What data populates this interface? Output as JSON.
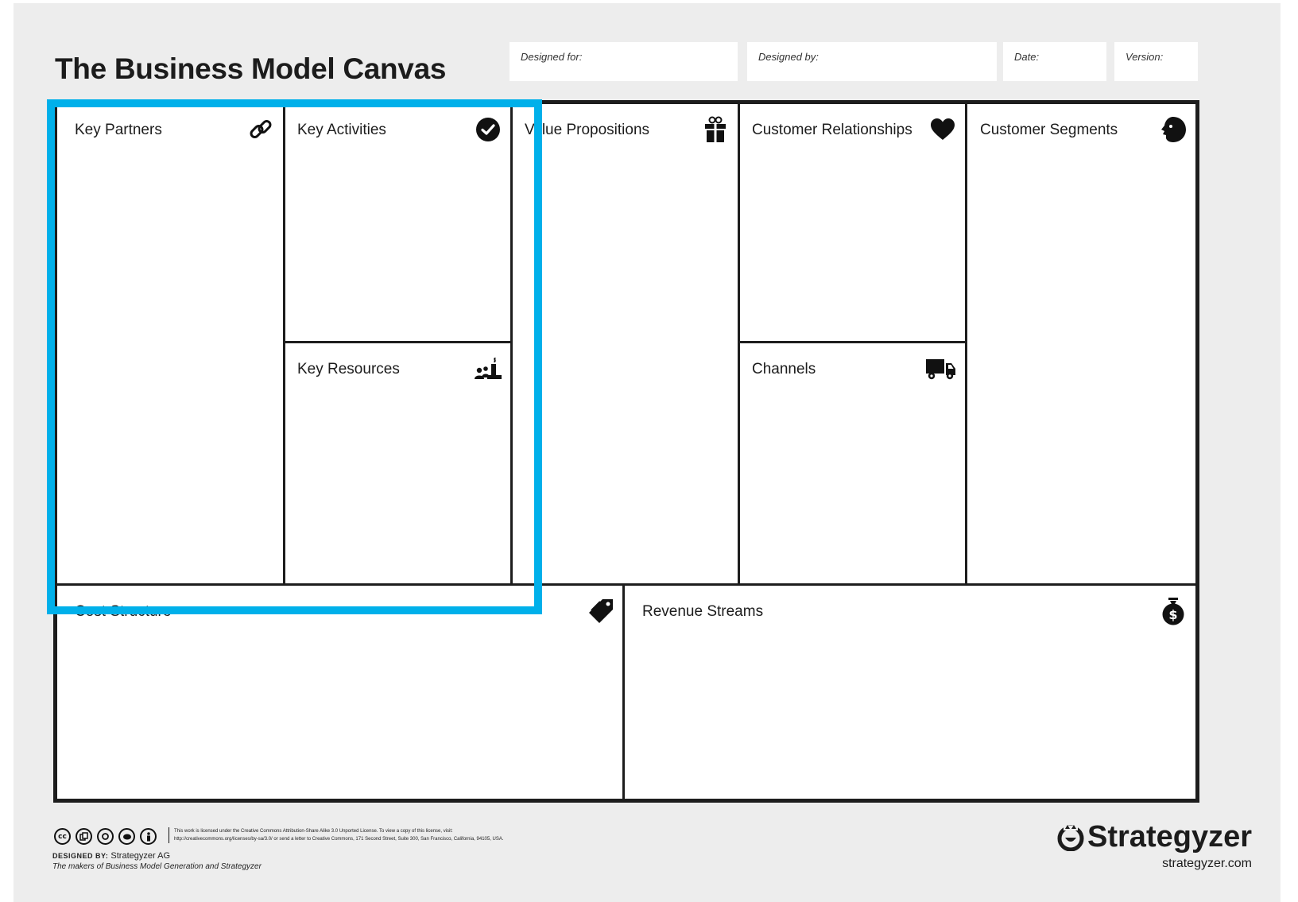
{
  "header": {
    "title": "The Business Model Canvas",
    "fields": [
      {
        "label": "Designed for:"
      },
      {
        "label": "Designed by:"
      },
      {
        "label": "Date:"
      },
      {
        "label": "Version:"
      }
    ]
  },
  "blocks": {
    "key_partners": {
      "label": "Key Partners",
      "icon": "link-icon"
    },
    "key_activities": {
      "label": "Key Activities",
      "icon": "check-circle-icon"
    },
    "key_resources": {
      "label": "Key Resources",
      "icon": "factory-people-icon"
    },
    "value_propositions": {
      "label": "Value Propositions",
      "icon": "gift-icon"
    },
    "customer_relationships": {
      "label": "Customer Relationships",
      "icon": "heart-icon"
    },
    "channels": {
      "label": "Channels",
      "icon": "truck-icon"
    },
    "customer_segments": {
      "label": "Customer Segments",
      "icon": "face-icon"
    },
    "cost_structure": {
      "label": "Cost Structure",
      "icon": "price-tag-icon"
    },
    "revenue_streams": {
      "label": "Revenue Streams",
      "icon": "money-bag-icon"
    }
  },
  "highlight": {
    "color": "#00b0ea"
  },
  "footer": {
    "license_line1": "This work is licensed under the Creative Commons Attribution-Share Alike 3.0 Unported License. To view a copy of this license, visit:",
    "license_line2": "http://creativecommons.org/licenses/by-sa/3.0/ or send a letter to Creative Commons, 171 Second Street, Suite 300, San Francisco, California, 94105, USA.",
    "designed_by_label": "DESIGNED BY:",
    "designed_by_value": "Strategyzer AG",
    "makers": "The makers of Business Model Generation and Strategyzer",
    "brand": "Strategyzer",
    "brand_url": "strategyzer.com",
    "cc_icons": [
      "cc-icon",
      "attribution-icon",
      "share-alike-icon",
      "noncommercial-icon",
      "person-icon"
    ]
  }
}
